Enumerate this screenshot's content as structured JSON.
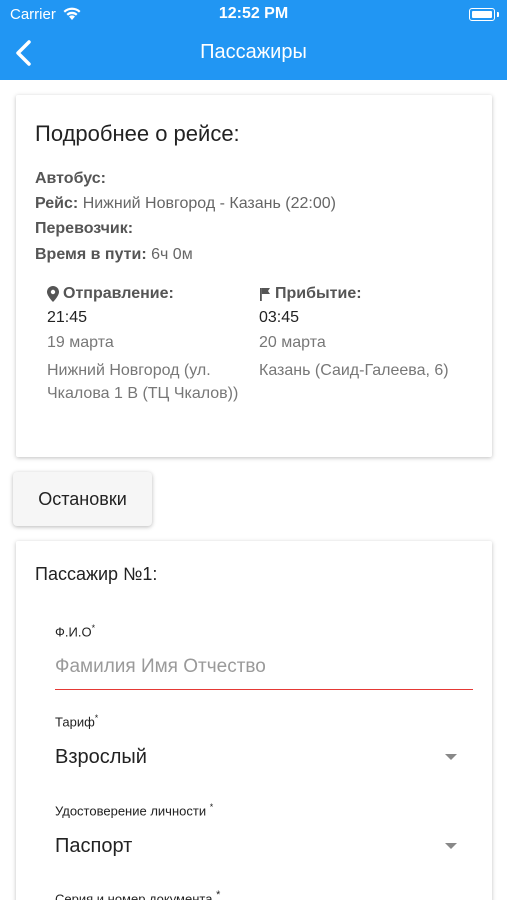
{
  "status_bar": {
    "carrier": "Carrier",
    "time": "12:52 PM"
  },
  "nav": {
    "title": "Пассажиры"
  },
  "trip": {
    "title": "Подробнее о рейсе:",
    "bus_label": "Автобус:",
    "route_label": "Рейс:",
    "route_value": "Нижний Новгород - Казань (22:00)",
    "carrier_label": "Перевозчик:",
    "duration_label": "Время в пути:",
    "duration_value": "6ч 0м",
    "departure": {
      "label": "Отправление:",
      "time": "21:45",
      "date": "19 марта",
      "address": "Нижний Новгород (ул. Чкалова 1 В (ТЦ Чкалов))"
    },
    "arrival": {
      "label": "Прибытие:",
      "time": "03:45",
      "date": "20 марта",
      "address": "Казань (Саид-Галеева, 6)"
    }
  },
  "stops_button": "Остановки",
  "passenger": {
    "title": "Пассажир №1:",
    "fio_label": "Ф.И.О",
    "fio_placeholder": "Фамилия Имя Отчество",
    "tariff_label": "Тариф",
    "tariff_value": "Взрослый",
    "id_label": "Удостоверение личности ",
    "id_value": "Паспорт",
    "doc_label": "Серия и номер документа "
  },
  "required_mark": "*",
  "colors": {
    "accent": "#2196f3",
    "error": "#e53935"
  }
}
